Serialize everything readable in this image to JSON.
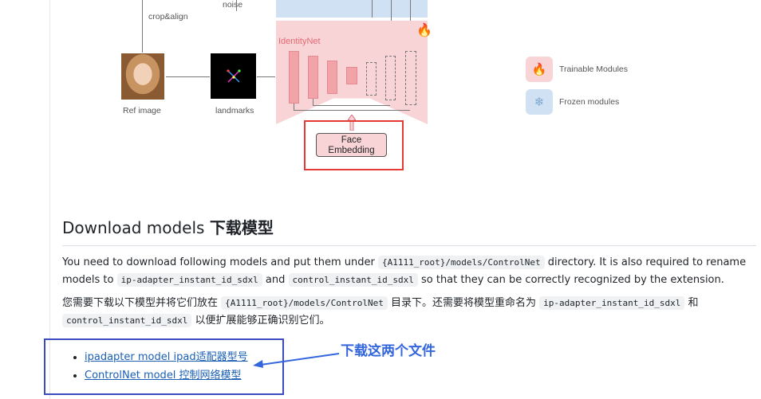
{
  "diagram": {
    "labels": {
      "noise": "noise",
      "crop_align": "crop&align",
      "ref_image": "Ref image",
      "landmarks": "landmarks",
      "identitynet": "IdentityNet",
      "face_embedding_line1": "Face",
      "face_embedding_line2": "Embedding"
    },
    "legend": [
      {
        "label": "Trainable Modules",
        "icon": "fire-icon",
        "color": "#f8d4d6"
      },
      {
        "label": "Frozen modules",
        "icon": "snowflake-icon",
        "color": "#cfe1f2"
      }
    ]
  },
  "section": {
    "heading_en": "Download models",
    "heading_zh": "下载模型"
  },
  "paragraph_en": {
    "t1": "You need to download following models and put them under",
    "code1": "{A1111_root}/models/ControlNet",
    "t2": "directory. It is also required to rename models to",
    "code2": "ip-adapter_instant_id_sdxl",
    "t3": "and",
    "code3": "control_instant_id_sdxl",
    "t4": "so that they can be correctly recognized by the extension."
  },
  "paragraph_zh": {
    "t1": "您需要下载以下模型并将它们放在",
    "code1": "{A1111_root}/models/ControlNet",
    "t2": "目录下。还需要将模型重命名为",
    "code2": "ip-adapter_instant_id_sdxl",
    "t3": "和",
    "code3": "control_instant_id_sdxl",
    "t4": "以便扩展能够正确识别它们。"
  },
  "links": [
    {
      "label": "ipadapter model ipad适配器型号"
    },
    {
      "label": "ControlNet model  控制网络模型"
    }
  ],
  "annotation": {
    "note": "下载这两个文件",
    "color": "#3366dd"
  }
}
